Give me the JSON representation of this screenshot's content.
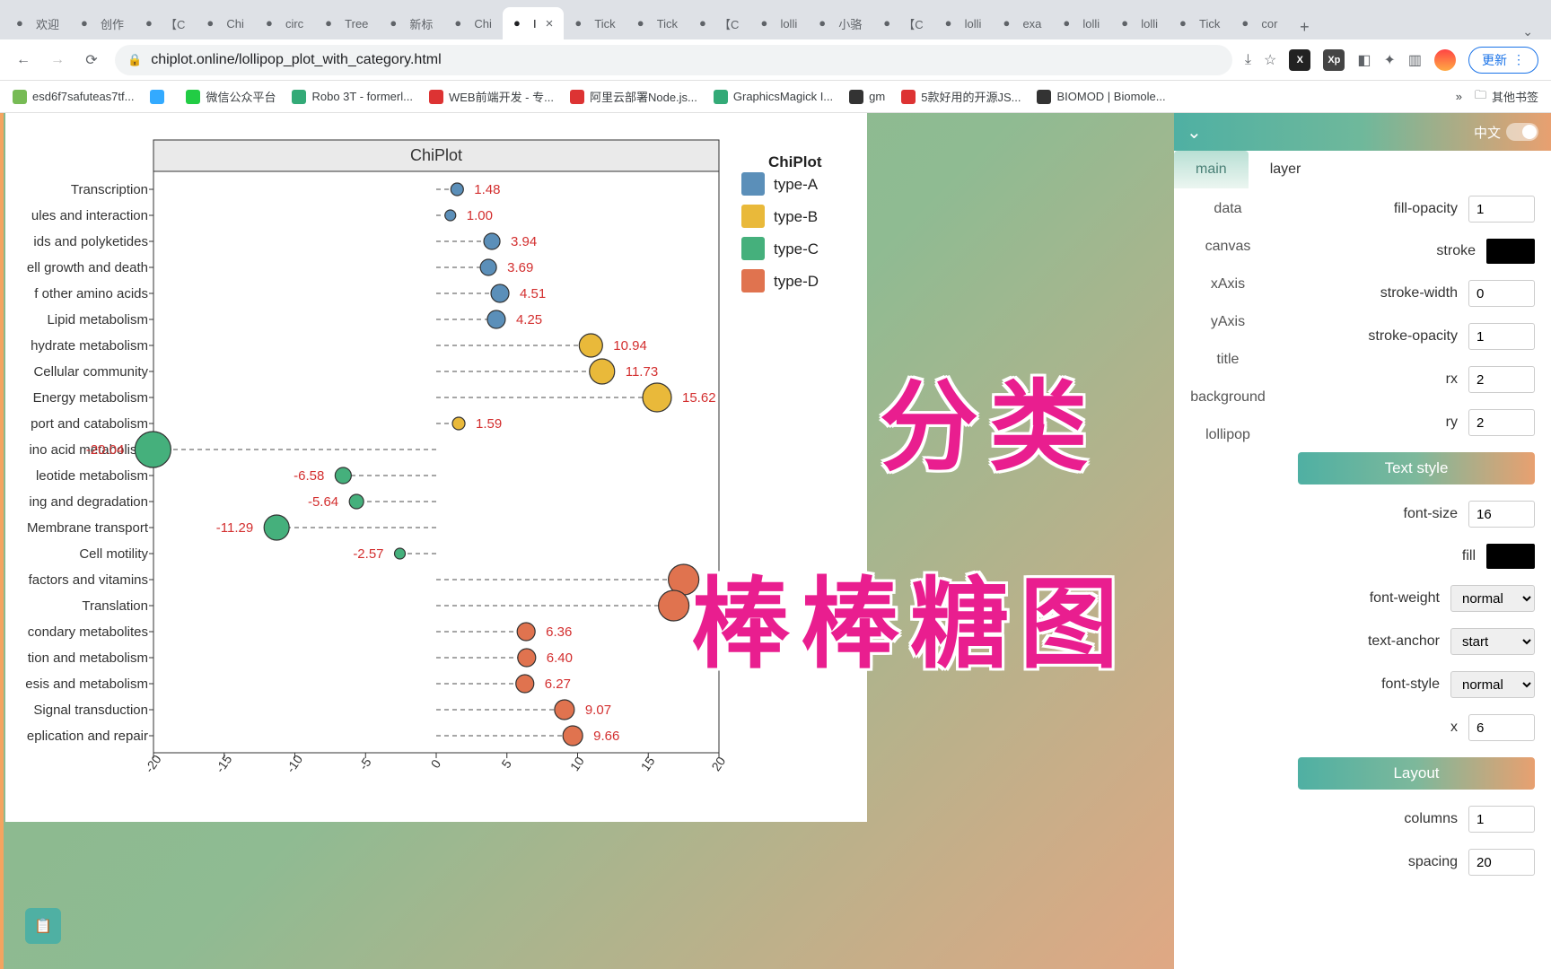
{
  "browser": {
    "tabs": [
      "欢迎",
      "创作",
      "【C",
      "Chi",
      "circ",
      "Tree",
      "新标",
      "Chi",
      "I",
      "Tick",
      "Tick",
      "【C",
      "lolli",
      "小骆",
      "【C",
      "lolli",
      "exa",
      "lolli",
      "lolli",
      "Tick",
      "cor"
    ],
    "active_tab_index": 8,
    "url": "chiplot.online/lollipop_plot_with_category.html",
    "update_label": "更新",
    "bookmarks": [
      "esd6f7safuteas7tf...",
      "",
      "微信公众平台",
      "Robo 3T - formerl...",
      "WEB前端开发 - 专...",
      "阿里云部署Node.js...",
      "GraphicsMagick I...",
      "gm",
      "5款好用的开源JS...",
      "BIOMOD | Biomole..."
    ],
    "other_bookmarks": "其他书签"
  },
  "overlay": {
    "line1": "分类",
    "line2": "棒棒糖图"
  },
  "chart_data": {
    "type": "lollipop",
    "title": "ChiPlot",
    "legend_title": "ChiPlot",
    "xlim": [
      -20,
      20
    ],
    "xticks": [
      -20,
      -15,
      -10,
      -5,
      0,
      5,
      10,
      15,
      20
    ],
    "categories": [
      "type-A",
      "type-B",
      "type-C",
      "type-D"
    ],
    "colors": {
      "type-A": "#5b8fb9",
      "type-B": "#e9b93a",
      "type-C": "#45b07c",
      "type-D": "#e0734f"
    },
    "series": [
      {
        "label": "Transcription",
        "value": 1.48,
        "category": "type-A",
        "size": 7
      },
      {
        "label": "ules and interaction",
        "value": 1.0,
        "category": "type-A",
        "size": 6
      },
      {
        "label": "ids and polyketides",
        "value": 3.94,
        "category": "type-A",
        "size": 9
      },
      {
        "label": "ell growth and death",
        "value": 3.69,
        "category": "type-A",
        "size": 9
      },
      {
        "label": "f other amino acids",
        "value": 4.51,
        "category": "type-A",
        "size": 10
      },
      {
        "label": "Lipid metabolism",
        "value": 4.25,
        "category": "type-A",
        "size": 10
      },
      {
        "label": "hydrate metabolism",
        "value": 10.94,
        "category": "type-B",
        "size": 13
      },
      {
        "label": "Cellular community",
        "value": 11.73,
        "category": "type-B",
        "size": 14
      },
      {
        "label": "Energy metabolism",
        "value": 15.62,
        "category": "type-B",
        "size": 16
      },
      {
        "label": "port and catabolism",
        "value": 1.59,
        "category": "type-B",
        "size": 7
      },
      {
        "label": "ino acid metabolism",
        "value": -20.04,
        "category": "type-C",
        "size": 20
      },
      {
        "label": "leotide metabolism",
        "value": -6.58,
        "category": "type-C",
        "size": 9
      },
      {
        "label": "ing and degradation",
        "value": -5.64,
        "category": "type-C",
        "size": 8
      },
      {
        "label": "Membrane transport",
        "value": -11.29,
        "category": "type-C",
        "size": 14
      },
      {
        "label": "Cell motility",
        "value": -2.57,
        "category": "type-C",
        "size": 6
      },
      {
        "label": "factors and vitamins",
        "value": 17.5,
        "category": "type-D",
        "size": 17,
        "suppress_label": true
      },
      {
        "label": "Translation",
        "value": 16.8,
        "category": "type-D",
        "size": 17,
        "suppress_label": true
      },
      {
        "label": "condary metabolites",
        "value": 6.36,
        "category": "type-D",
        "size": 10
      },
      {
        "label": "tion and metabolism",
        "value": 6.4,
        "category": "type-D",
        "size": 10
      },
      {
        "label": "esis and metabolism",
        "value": 6.27,
        "category": "type-D",
        "size": 10
      },
      {
        "label": "Signal transduction",
        "value": 9.07,
        "category": "type-D",
        "size": 11
      },
      {
        "label": "eplication and repair",
        "value": 9.66,
        "category": "type-D",
        "size": 11
      }
    ]
  },
  "sidebar": {
    "lang": "中文",
    "tabs": [
      "main",
      "layer"
    ],
    "active_tab": 0,
    "menu": [
      "data",
      "canvas",
      "xAxis",
      "yAxis",
      "title",
      "background",
      "lollipop"
    ],
    "props_top": {
      "fill_opacity_label": "fill-opacity",
      "fill_opacity": "1",
      "stroke_label": "stroke",
      "stroke_width_label": "stroke-width",
      "stroke_width": "0",
      "stroke_opacity_label": "stroke-opacity",
      "stroke_opacity": "1",
      "rx_label": "rx",
      "rx": "2",
      "ry_label": "ry",
      "ry": "2"
    },
    "section_text": "Text style",
    "props_text": {
      "font_size_label": "font-size",
      "font_size": "16",
      "fill_label": "fill",
      "font_weight_label": "font-weight",
      "font_weight": "normal",
      "text_anchor_label": "text-anchor",
      "text_anchor": "start",
      "font_style_label": "font-style",
      "font_style": "normal",
      "x_label": "x",
      "x": "6"
    },
    "section_layout": "Layout",
    "props_layout": {
      "columns_label": "columns",
      "columns": "1",
      "spacing_label": "spacing",
      "spacing": "20"
    }
  }
}
